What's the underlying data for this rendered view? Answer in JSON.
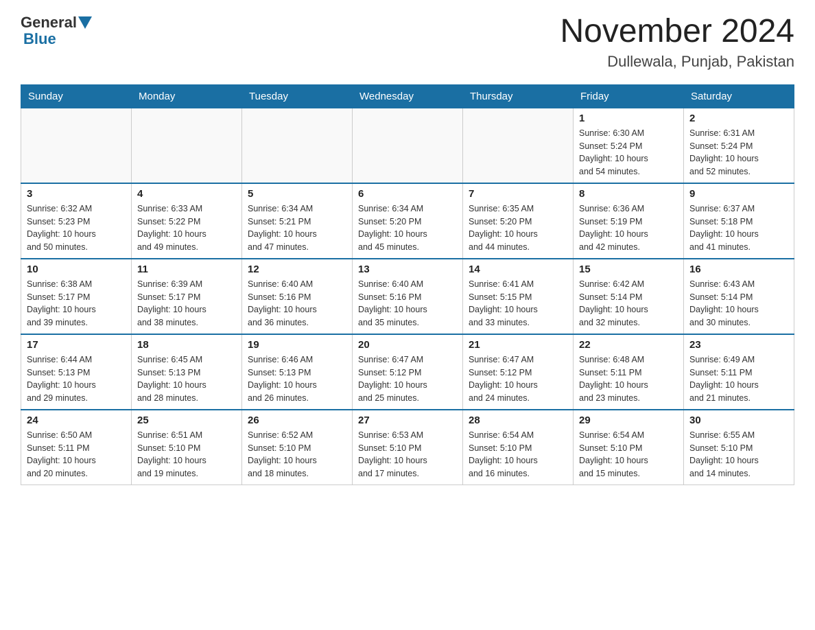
{
  "header": {
    "logo_general": "General",
    "logo_blue": "Blue",
    "month_title": "November 2024",
    "location": "Dullewala, Punjab, Pakistan"
  },
  "days_of_week": [
    "Sunday",
    "Monday",
    "Tuesday",
    "Wednesday",
    "Thursday",
    "Friday",
    "Saturday"
  ],
  "weeks": [
    [
      {
        "day": "",
        "info": ""
      },
      {
        "day": "",
        "info": ""
      },
      {
        "day": "",
        "info": ""
      },
      {
        "day": "",
        "info": ""
      },
      {
        "day": "",
        "info": ""
      },
      {
        "day": "1",
        "info": "Sunrise: 6:30 AM\nSunset: 5:24 PM\nDaylight: 10 hours\nand 54 minutes."
      },
      {
        "day": "2",
        "info": "Sunrise: 6:31 AM\nSunset: 5:24 PM\nDaylight: 10 hours\nand 52 minutes."
      }
    ],
    [
      {
        "day": "3",
        "info": "Sunrise: 6:32 AM\nSunset: 5:23 PM\nDaylight: 10 hours\nand 50 minutes."
      },
      {
        "day": "4",
        "info": "Sunrise: 6:33 AM\nSunset: 5:22 PM\nDaylight: 10 hours\nand 49 minutes."
      },
      {
        "day": "5",
        "info": "Sunrise: 6:34 AM\nSunset: 5:21 PM\nDaylight: 10 hours\nand 47 minutes."
      },
      {
        "day": "6",
        "info": "Sunrise: 6:34 AM\nSunset: 5:20 PM\nDaylight: 10 hours\nand 45 minutes."
      },
      {
        "day": "7",
        "info": "Sunrise: 6:35 AM\nSunset: 5:20 PM\nDaylight: 10 hours\nand 44 minutes."
      },
      {
        "day": "8",
        "info": "Sunrise: 6:36 AM\nSunset: 5:19 PM\nDaylight: 10 hours\nand 42 minutes."
      },
      {
        "day": "9",
        "info": "Sunrise: 6:37 AM\nSunset: 5:18 PM\nDaylight: 10 hours\nand 41 minutes."
      }
    ],
    [
      {
        "day": "10",
        "info": "Sunrise: 6:38 AM\nSunset: 5:17 PM\nDaylight: 10 hours\nand 39 minutes."
      },
      {
        "day": "11",
        "info": "Sunrise: 6:39 AM\nSunset: 5:17 PM\nDaylight: 10 hours\nand 38 minutes."
      },
      {
        "day": "12",
        "info": "Sunrise: 6:40 AM\nSunset: 5:16 PM\nDaylight: 10 hours\nand 36 minutes."
      },
      {
        "day": "13",
        "info": "Sunrise: 6:40 AM\nSunset: 5:16 PM\nDaylight: 10 hours\nand 35 minutes."
      },
      {
        "day": "14",
        "info": "Sunrise: 6:41 AM\nSunset: 5:15 PM\nDaylight: 10 hours\nand 33 minutes."
      },
      {
        "day": "15",
        "info": "Sunrise: 6:42 AM\nSunset: 5:14 PM\nDaylight: 10 hours\nand 32 minutes."
      },
      {
        "day": "16",
        "info": "Sunrise: 6:43 AM\nSunset: 5:14 PM\nDaylight: 10 hours\nand 30 minutes."
      }
    ],
    [
      {
        "day": "17",
        "info": "Sunrise: 6:44 AM\nSunset: 5:13 PM\nDaylight: 10 hours\nand 29 minutes."
      },
      {
        "day": "18",
        "info": "Sunrise: 6:45 AM\nSunset: 5:13 PM\nDaylight: 10 hours\nand 28 minutes."
      },
      {
        "day": "19",
        "info": "Sunrise: 6:46 AM\nSunset: 5:13 PM\nDaylight: 10 hours\nand 26 minutes."
      },
      {
        "day": "20",
        "info": "Sunrise: 6:47 AM\nSunset: 5:12 PM\nDaylight: 10 hours\nand 25 minutes."
      },
      {
        "day": "21",
        "info": "Sunrise: 6:47 AM\nSunset: 5:12 PM\nDaylight: 10 hours\nand 24 minutes."
      },
      {
        "day": "22",
        "info": "Sunrise: 6:48 AM\nSunset: 5:11 PM\nDaylight: 10 hours\nand 23 minutes."
      },
      {
        "day": "23",
        "info": "Sunrise: 6:49 AM\nSunset: 5:11 PM\nDaylight: 10 hours\nand 21 minutes."
      }
    ],
    [
      {
        "day": "24",
        "info": "Sunrise: 6:50 AM\nSunset: 5:11 PM\nDaylight: 10 hours\nand 20 minutes."
      },
      {
        "day": "25",
        "info": "Sunrise: 6:51 AM\nSunset: 5:10 PM\nDaylight: 10 hours\nand 19 minutes."
      },
      {
        "day": "26",
        "info": "Sunrise: 6:52 AM\nSunset: 5:10 PM\nDaylight: 10 hours\nand 18 minutes."
      },
      {
        "day": "27",
        "info": "Sunrise: 6:53 AM\nSunset: 5:10 PM\nDaylight: 10 hours\nand 17 minutes."
      },
      {
        "day": "28",
        "info": "Sunrise: 6:54 AM\nSunset: 5:10 PM\nDaylight: 10 hours\nand 16 minutes."
      },
      {
        "day": "29",
        "info": "Sunrise: 6:54 AM\nSunset: 5:10 PM\nDaylight: 10 hours\nand 15 minutes."
      },
      {
        "day": "30",
        "info": "Sunrise: 6:55 AM\nSunset: 5:10 PM\nDaylight: 10 hours\nand 14 minutes."
      }
    ]
  ]
}
